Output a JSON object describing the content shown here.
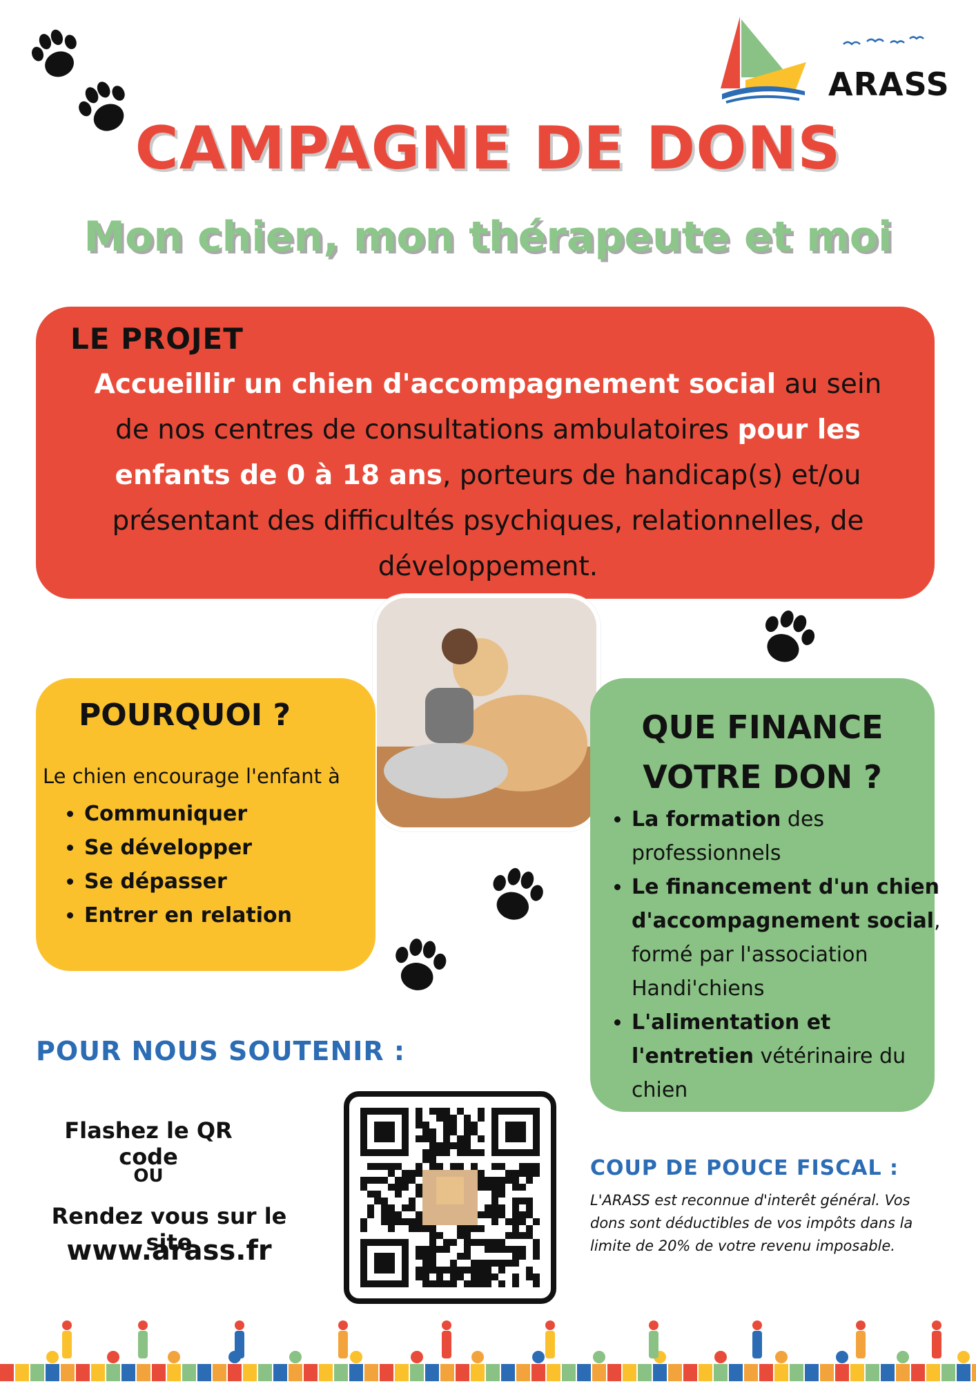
{
  "logo": {
    "text": "ARASS"
  },
  "header": {
    "title": "CAMPAGNE DE DONS",
    "subtitle": "Mon chien, mon thérapeute et moi"
  },
  "projet": {
    "heading": "LE PROJET",
    "bold_1": "Accueillir un chien d'accompagnement social",
    "text_1": " au sein de nos centres de consultations ambulatoires ",
    "bold_2": "pour les  enfants de 0 à 18 ans",
    "text_2": ", porteurs de handicap(s) et/ou présentant des difficultés psychiques, relationnelles, de développement."
  },
  "pourquoi": {
    "heading": "POURQUOI ?",
    "intro": "Le chien encourage l'enfant à",
    "items": [
      "Communiquer",
      "Se développer",
      "Se dépasser",
      "Entrer en relation"
    ]
  },
  "finance": {
    "heading_line1": "QUE FINANCE",
    "heading_line2": "VOTRE DON ?",
    "items": [
      {
        "bold": "La formation",
        "text": " des professionnels"
      },
      {
        "bold": "Le financement d'un chien d'accompagnement social",
        "text": ", formé par l'association Handi'chiens"
      },
      {
        "bold": "L'alimentation et l'entretien",
        "text": " vétérinaire du chien"
      }
    ]
  },
  "soutenir": {
    "heading": "POUR NOUS SOUTENIR :",
    "flash": "Flashez le QR code",
    "ou": "OU",
    "rendez": "Rendez vous sur le site",
    "url": "www.arass.fr"
  },
  "fiscal": {
    "heading": "COUP DE POUCE FISCAL :",
    "text": "L'ARASS est reconnue d'interêt général. Vos dons sont déductibles de vos impôts dans la limite de 20% de votre revenu imposable."
  },
  "colors": {
    "red": "#e84b39",
    "yellow": "#fbc12d",
    "green": "#89c284",
    "blue": "#2b6cb5"
  }
}
